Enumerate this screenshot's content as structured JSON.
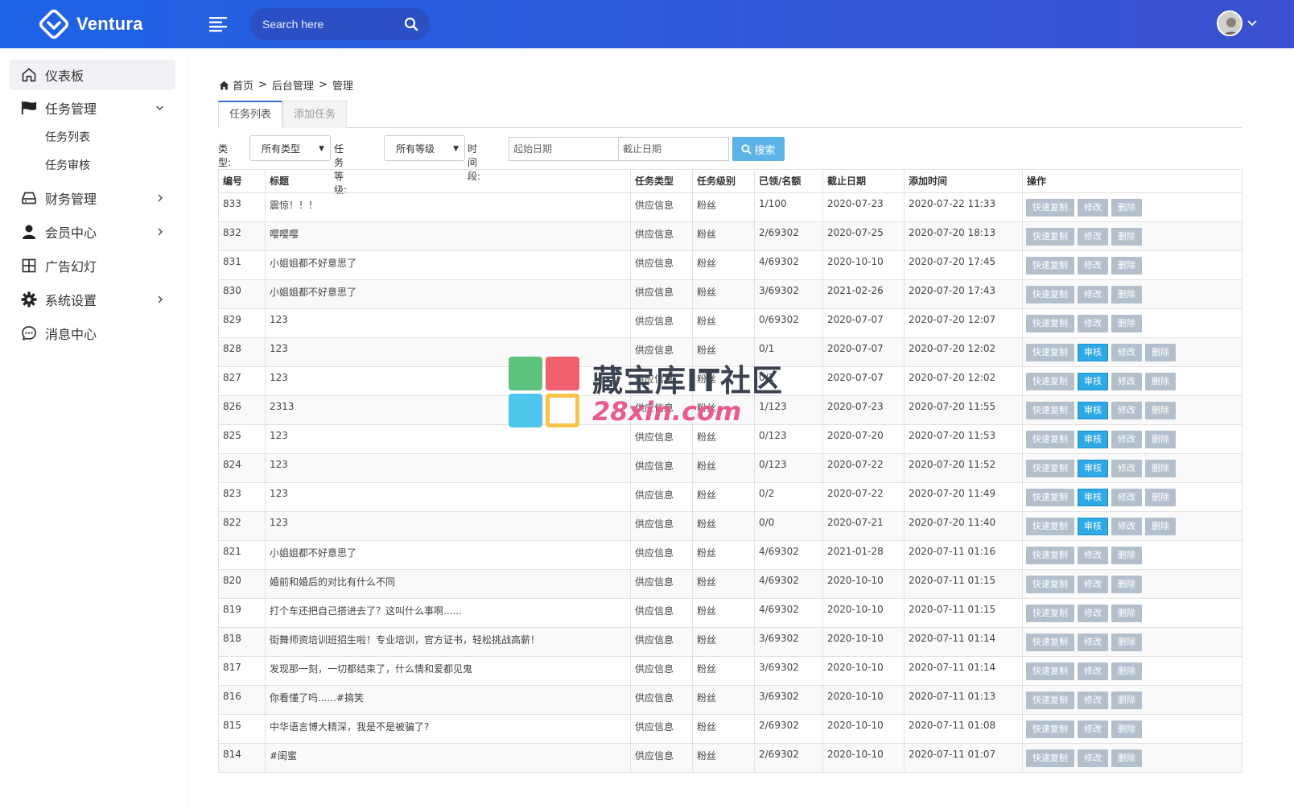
{
  "app": {
    "name": "Ventura"
  },
  "header": {
    "search_placeholder": "Search here"
  },
  "sidebar": {
    "items": [
      {
        "label": "仪表板",
        "icon": "home-icon"
      },
      {
        "label": "任务管理",
        "icon": "flag-icon",
        "sub": [
          "任务列表",
          "任务审核"
        ]
      },
      {
        "label": "财务管理",
        "icon": "hard-drive-icon"
      },
      {
        "label": "会员中心",
        "icon": "user-icon"
      },
      {
        "label": "广告幻灯",
        "icon": "grid-icon"
      },
      {
        "label": "系统设置",
        "icon": "gear-icon"
      },
      {
        "label": "消息中心",
        "icon": "chat-icon"
      }
    ]
  },
  "breadcrumb": [
    "首页",
    "后台管理",
    "管理"
  ],
  "tabs": [
    "任务列表",
    "添加任务"
  ],
  "filters": {
    "type_label": "类型:",
    "type_value": "所有类型",
    "level_label": "任务等级:",
    "level_value": "所有等级",
    "period_label": "时间段:",
    "start_placeholder": "起始日期",
    "end_placeholder": "截止日期",
    "search_button": "搜索"
  },
  "table": {
    "headers": [
      "编号",
      "标题",
      "任务类型",
      "任务级别",
      "已领/名额",
      "截止日期",
      "添加时间",
      "操作"
    ],
    "action_labels": {
      "copy": "快速复制",
      "audit": "审核",
      "edit": "修改",
      "delete": "删除"
    },
    "rows": [
      {
        "id": "833",
        "title": "震惊！！！",
        "type": "供应信息",
        "level": "粉丝",
        "quota": "1/100",
        "deadline": "2020-07-23",
        "added": "2020-07-22 11:33",
        "audit": false
      },
      {
        "id": "832",
        "title": "嘤嘤嘤",
        "type": "供应信息",
        "level": "粉丝",
        "quota": "2/69302",
        "deadline": "2020-07-25",
        "added": "2020-07-20 18:13",
        "audit": false
      },
      {
        "id": "831",
        "title": "小姐姐都不好意思了",
        "type": "供应信息",
        "level": "粉丝",
        "quota": "4/69302",
        "deadline": "2020-10-10",
        "added": "2020-07-20 17:45",
        "audit": false
      },
      {
        "id": "830",
        "title": "小姐姐都不好意思了",
        "type": "供应信息",
        "level": "粉丝",
        "quota": "3/69302",
        "deadline": "2021-02-26",
        "added": "2020-07-20 17:43",
        "audit": false
      },
      {
        "id": "829",
        "title": "123",
        "type": "供应信息",
        "level": "粉丝",
        "quota": "0/69302",
        "deadline": "2020-07-07",
        "added": "2020-07-20 12:07",
        "audit": false
      },
      {
        "id": "828",
        "title": "123",
        "type": "供应信息",
        "level": "粉丝",
        "quota": "0/1",
        "deadline": "2020-07-07",
        "added": "2020-07-20 12:02",
        "audit": true
      },
      {
        "id": "827",
        "title": "123",
        "type": "供应信息",
        "level": "粉丝",
        "quota": "0/1",
        "deadline": "2020-07-07",
        "added": "2020-07-20 12:02",
        "audit": true
      },
      {
        "id": "826",
        "title": "2313",
        "type": "供应信息",
        "level": "粉丝",
        "quota": "1/123",
        "deadline": "2020-07-23",
        "added": "2020-07-20 11:55",
        "audit": true
      },
      {
        "id": "825",
        "title": "123",
        "type": "供应信息",
        "level": "粉丝",
        "quota": "0/123",
        "deadline": "2020-07-20",
        "added": "2020-07-20 11:53",
        "audit": true
      },
      {
        "id": "824",
        "title": "123",
        "type": "供应信息",
        "level": "粉丝",
        "quota": "0/123",
        "deadline": "2020-07-22",
        "added": "2020-07-20 11:52",
        "audit": true
      },
      {
        "id": "823",
        "title": "123",
        "type": "供应信息",
        "level": "粉丝",
        "quota": "0/2",
        "deadline": "2020-07-22",
        "added": "2020-07-20 11:49",
        "audit": true
      },
      {
        "id": "822",
        "title": "123",
        "type": "供应信息",
        "level": "粉丝",
        "quota": "0/0",
        "deadline": "2020-07-21",
        "added": "2020-07-20 11:40",
        "audit": true
      },
      {
        "id": "821",
        "title": "小姐姐都不好意思了",
        "type": "供应信息",
        "level": "粉丝",
        "quota": "4/69302",
        "deadline": "2021-01-28",
        "added": "2020-07-11 01:16",
        "audit": false
      },
      {
        "id": "820",
        "title": "婚前和婚后的对比有什么不同",
        "type": "供应信息",
        "level": "粉丝",
        "quota": "4/69302",
        "deadline": "2020-10-10",
        "added": "2020-07-11 01:15",
        "audit": false
      },
      {
        "id": "819",
        "title": "打个车还把自己搭进去了？这叫什么事啊......",
        "type": "供应信息",
        "level": "粉丝",
        "quota": "4/69302",
        "deadline": "2020-10-10",
        "added": "2020-07-11 01:15",
        "audit": false
      },
      {
        "id": "818",
        "title": "街舞师资培训班招生啦！专业培训，官方证书，轻松挑战高薪！",
        "type": "供应信息",
        "level": "粉丝",
        "quota": "3/69302",
        "deadline": "2020-10-10",
        "added": "2020-07-11 01:14",
        "audit": false
      },
      {
        "id": "817",
        "title": "发现那一刻，一切都结束了，什么情和爱都见鬼",
        "type": "供应信息",
        "level": "粉丝",
        "quota": "3/69302",
        "deadline": "2020-10-10",
        "added": "2020-07-11 01:14",
        "audit": false
      },
      {
        "id": "816",
        "title": "你看懂了吗......#搞笑",
        "type": "供应信息",
        "level": "粉丝",
        "quota": "3/69302",
        "deadline": "2020-10-10",
        "added": "2020-07-11 01:13",
        "audit": false
      },
      {
        "id": "815",
        "title": "中华语言博大精深，我是不是被骗了?",
        "type": "供应信息",
        "level": "粉丝",
        "quota": "2/69302",
        "deadline": "2020-10-10",
        "added": "2020-07-11 01:08",
        "audit": false
      },
      {
        "id": "814",
        "title": "#闺蜜",
        "type": "供应信息",
        "level": "粉丝",
        "quota": "2/69302",
        "deadline": "2020-10-10",
        "added": "2020-07-11 01:07",
        "audit": false
      }
    ]
  },
  "watermark": {
    "line1": "藏宝库IT社区",
    "line2": "28xin.com"
  },
  "colors": {
    "header": "#2a5ad9",
    "audit_button": "#2fa9e6",
    "action_button": "#b3c0cc",
    "search_button": "#5bb4e5"
  }
}
